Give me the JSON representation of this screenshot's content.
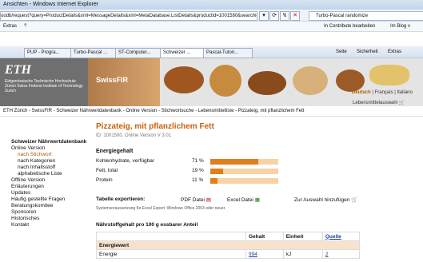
{
  "window": {
    "title": "Ansichten - Windows Internet Explorer"
  },
  "address": {
    "url": "oodb/request?query=ProductDetails&xml=MessageDetails&xml=MetaDatabase.ListDetails&productid=1001580&searchid=9",
    "search_value": "Turbo-Pascal randomize"
  },
  "menubar": {
    "items": [
      "Extras",
      "?"
    ],
    "contribute": "In Contribute bearbeiten",
    "blog": "Im Blog v"
  },
  "tabs": [
    {
      "label": "PUP - Progra..."
    },
    {
      "label": "Turbo-Pascal ..."
    },
    {
      "label": "ST-Computer..."
    },
    {
      "label": "Schweizer ...",
      "active": true
    },
    {
      "label": "Pascal-Tutori..."
    }
  ],
  "tools": {
    "page": "Seite ▾",
    "security": "Sicherheit ▾",
    "extras": "Extras ▾"
  },
  "banner": {
    "logo": "ETH",
    "subtitle": "Eidgenössische Technische Hochschule Zürich Swiss Federal Institute of Technology Zurich",
    "brand": "SwissFIR",
    "langs": [
      "Deutsch",
      "Français",
      "Italiano"
    ],
    "lebensmittel": "Lebensmittelauswahl"
  },
  "breadcrumb": "ETH Zürich - SwissFIR - Schweizer Nährwertdatenbank - Online Version - Stichwortsuche - Lebensmittelliste - Pizzateig, mit pflanzlichem Fett",
  "sidebar": {
    "title": "Schweizer Nährwertdatenbank",
    "items": [
      {
        "label": "Online Version",
        "level": 0
      },
      {
        "label": "nach Stichwort",
        "level": 1,
        "active": true
      },
      {
        "label": "nach Kategorien",
        "level": 1
      },
      {
        "label": "nach Inhaltsstoff",
        "level": 1
      },
      {
        "label": "alphabetische Liste",
        "level": 1
      },
      {
        "label": "Offline Version",
        "level": 0
      },
      {
        "label": "Erläuterungen",
        "level": 0
      },
      {
        "label": "Updates",
        "level": 0
      },
      {
        "label": "Häufig gestellte Fragen",
        "level": 0
      },
      {
        "label": "Beratungskomitee",
        "level": 0
      },
      {
        "label": "Sponsoren",
        "level": 0
      },
      {
        "label": "Historisches",
        "level": 0
      },
      {
        "label": "Kontakt",
        "level": 0
      }
    ]
  },
  "product": {
    "title": "Pizzateig, mit pflanzlichem Fett",
    "id": "ID: 1001580, Online Version V 3.01",
    "energy_heading": "Energiegehalt",
    "nutrients": [
      {
        "label": "Kohlenhydrate, verfügbar",
        "percent": "71 %",
        "value": 71
      },
      {
        "label": "Fett, total",
        "percent": "19 %",
        "value": 19
      },
      {
        "label": "Protein",
        "percent": "11 %",
        "value": 11
      }
    ],
    "bar_colors": {
      "fill": "#e07e1b",
      "track": "#f6d2a5"
    }
  },
  "export": {
    "label": "Tabelle exportieren:",
    "pdf": "PDF Datei",
    "excel": "Excel Datei",
    "auswahl": "Zur Auswahl hinzufügen",
    "sysreq": "Systemvoraussetzung für Excel Export: Windows Office 2003 oder neuer."
  },
  "table": {
    "heading": "Nährstoffgehalt pro 100 g essbarer Anteil",
    "columns": [
      "",
      "Gehalt",
      "Einheit",
      "Quelle"
    ],
    "category": "Energiewert",
    "rows": [
      {
        "name": "Energie",
        "value": "994",
        "unit": "kJ",
        "source": "2"
      }
    ]
  }
}
